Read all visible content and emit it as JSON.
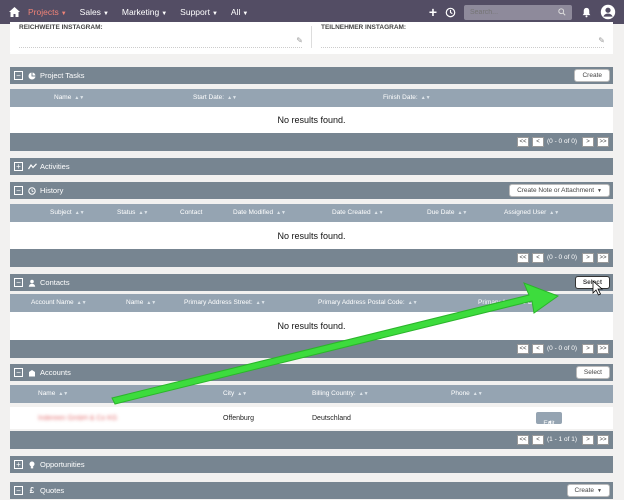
{
  "nav": {
    "items": [
      {
        "label": "Projects",
        "active": true
      },
      {
        "label": "Sales",
        "active": false
      },
      {
        "label": "Marketing",
        "active": false
      },
      {
        "label": "Support",
        "active": false
      },
      {
        "label": "All",
        "active": false
      }
    ],
    "search_placeholder": "Search...",
    "accent_color": "#f08377",
    "bar_color": "#534d64"
  },
  "fields": {
    "left_label": "REICHWEITE INSTAGRAM:",
    "right_label": "TEILNEHMER INSTAGRAM:"
  },
  "panels": {
    "project_tasks": {
      "title": "Project Tasks",
      "toggle": "−",
      "button": "Create",
      "columns": [
        "Name",
        "Start Date:",
        "Finish Date:"
      ],
      "empty": "No results found.",
      "pager_info": "(0 - 0 of 0)"
    },
    "activities": {
      "title": "Activities",
      "toggle": "+"
    },
    "history": {
      "title": "History",
      "toggle": "−",
      "button": "Create Note or Attachment",
      "columns": [
        "Subject",
        "Status",
        "Contact",
        "Date Modified",
        "Date Created",
        "Due Date",
        "Assigned User"
      ],
      "empty": "No results found.",
      "pager_info": "(0 - 0 of 0)"
    },
    "contacts": {
      "title": "Contacts",
      "toggle": "−",
      "button": "Select",
      "columns": [
        "Account Name",
        "Name",
        "Primary Address Street:",
        "Primary Address Postal Code:",
        "Primary Address City"
      ],
      "empty": "No results found.",
      "pager_info": "(0 - 0 of 0)"
    },
    "accounts": {
      "title": "Accounts",
      "toggle": "−",
      "button": "Select",
      "columns": [
        "Name",
        "City",
        "Billing Country:",
        "Phone"
      ],
      "rows": [
        {
          "name": "Indereen GmbH & Co KG",
          "city": "Offenburg",
          "country": "Deutschland",
          "phone": "",
          "action": "Edit"
        }
      ],
      "pager_info": "(1 - 1 of 1)"
    },
    "opportunities": {
      "title": "Opportunities",
      "toggle": "+"
    },
    "quotes": {
      "title": "Quotes",
      "toggle": "−",
      "button": "Create"
    }
  },
  "pager_buttons": {
    "first": "<<",
    "prev": "<",
    "next": ">",
    "last": ">>"
  },
  "annotation_color": "#3ddc3d"
}
